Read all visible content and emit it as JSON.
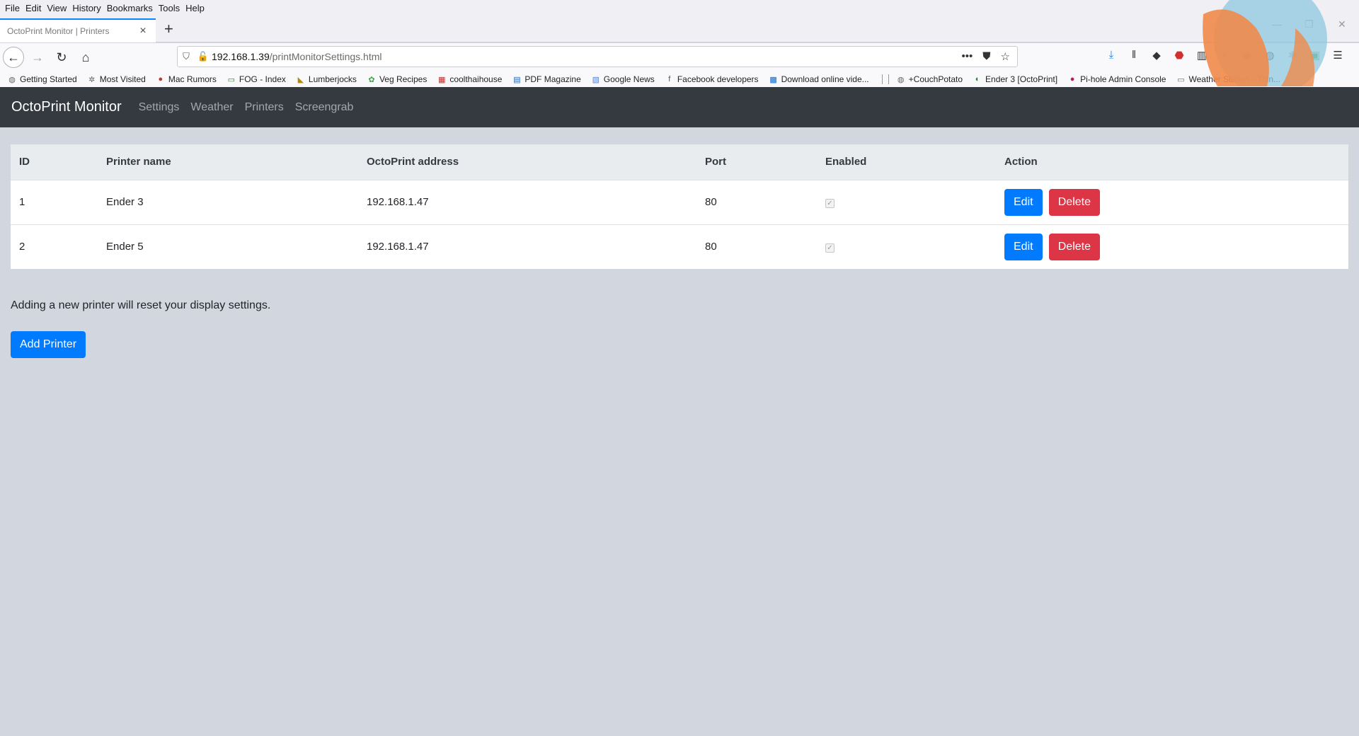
{
  "browser": {
    "menu": [
      "File",
      "Edit",
      "View",
      "History",
      "Bookmarks",
      "Tools",
      "Help"
    ],
    "tab_title": "OctoPrint Monitor | Printers",
    "url_host": "192.168.1.39",
    "url_path": "/printMonitorSettings.html",
    "bookmarks": [
      "Getting Started",
      "Most Visited",
      "Mac Rumors",
      "FOG - Index",
      "Lumberjocks",
      "Veg Recipes",
      "coolthaihouse",
      "PDF Magazine",
      "Google News",
      "Facebook developers",
      "Download online vide...",
      "+CouchPotato",
      "Ender 3 [OctoPrint]",
      "Pi-hole Admin Console",
      "Weather Station - Thin..."
    ]
  },
  "app": {
    "brand": "OctoPrint Monitor",
    "nav": [
      "Settings",
      "Weather",
      "Printers",
      "Screengrab"
    ]
  },
  "table": {
    "headers": [
      "ID",
      "Printer name",
      "OctoPrint address",
      "Port",
      "Enabled",
      "Action"
    ],
    "rows": [
      {
        "id": "1",
        "name": "Ender 3",
        "address": "192.168.1.47",
        "port": "80",
        "enabled": true
      },
      {
        "id": "2",
        "name": "Ender 5",
        "address": "192.168.1.47",
        "port": "80",
        "enabled": true
      }
    ],
    "edit_label": "Edit",
    "delete_label": "Delete"
  },
  "note": "Adding a new printer will reset your display settings.",
  "add_button": "Add Printer",
  "colors": {
    "navbar": "#343a40",
    "primary": "#007bff",
    "danger": "#dc3545",
    "page_bg": "#d2d6de"
  }
}
